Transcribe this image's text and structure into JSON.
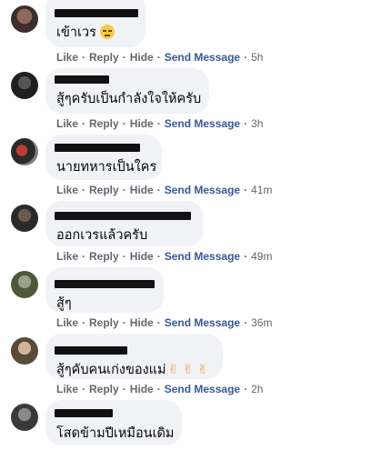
{
  "actions": {
    "like": "Like",
    "reply": "Reply",
    "hide": "Hide",
    "send": "Send Message",
    "dot": "·"
  },
  "comments": [
    {
      "text": "เข้าเวร",
      "emoji": "😑",
      "time": "5h"
    },
    {
      "text": "สู้ๆครับเป็นกำลังใจให้ครับ",
      "time": "3h"
    },
    {
      "text": "นายทหารเป็นใคร",
      "time": "41m"
    },
    {
      "text": "ออกเวรแล้วครับ",
      "time": "49m"
    },
    {
      "text": "สู้ๆ",
      "time": "36m"
    },
    {
      "text": "สู้ๆคับคนเก่งของแม่",
      "emoji": "✌ ✌ ✌",
      "time": "2h"
    },
    {
      "text": "โสดข้ามปีเหมือนเดิม",
      "time": ""
    }
  ],
  "colors": {
    "bubble": "#f0f2f5",
    "action_text": "#65676b",
    "send_message": "#385898"
  }
}
